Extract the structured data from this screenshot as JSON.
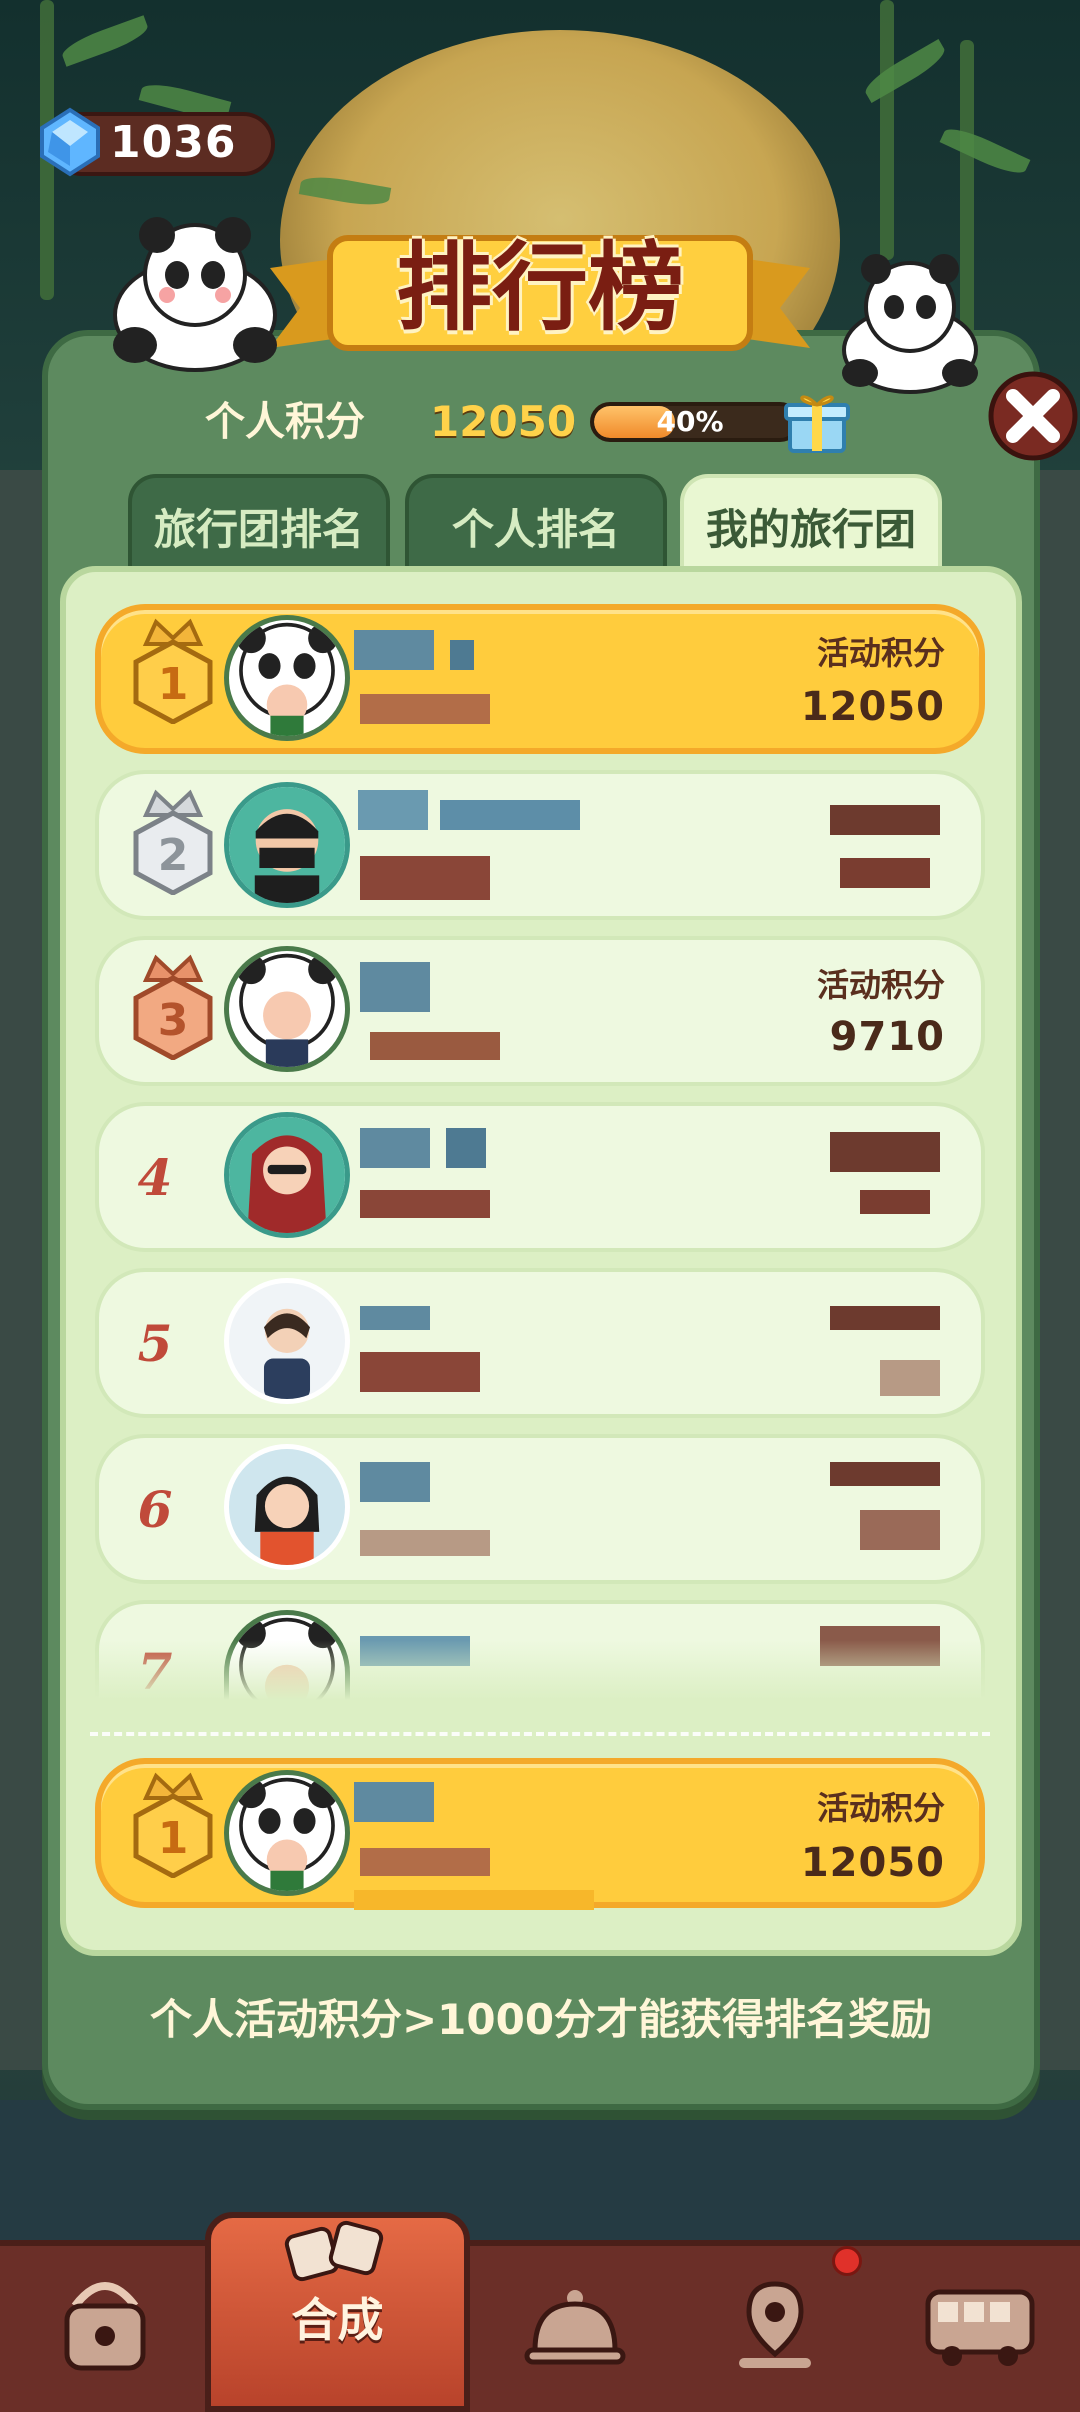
{
  "currency": {
    "icon": "diamond-icon",
    "amount": "1036"
  },
  "header": {
    "title": "排行榜"
  },
  "score": {
    "label": "个人积分",
    "value": "12050",
    "progress": 0.4,
    "progress_text": "40%",
    "reward_icon": "gift-box-icon"
  },
  "tabs": [
    {
      "label": "旅行团排名",
      "active": false
    },
    {
      "label": "个人排名",
      "active": false
    },
    {
      "label": "我的旅行团",
      "active": true
    }
  ],
  "rows": [
    {
      "rank": "1",
      "rank_style": "gold-medal",
      "points_label": "活动积分",
      "points": "12050",
      "highlighted": true,
      "avatar": "panda-hood-avatar"
    },
    {
      "rank": "2",
      "rank_style": "silver-medal",
      "points_label": "",
      "points": "",
      "highlighted": false,
      "avatar": "ninja-avatar"
    },
    {
      "rank": "3",
      "rank_style": "bronze-medal",
      "points_label": "活动积分",
      "points": "9710",
      "highlighted": false,
      "avatar": "panda-hood-avatar"
    },
    {
      "rank": "4",
      "rank_style": "number",
      "points_label": "",
      "points": "",
      "highlighted": false,
      "avatar": "girl-sunglasses-avatar"
    },
    {
      "rank": "5",
      "rank_style": "number",
      "points_label": "",
      "points": "",
      "highlighted": false,
      "avatar": "girl-photo-avatar"
    },
    {
      "rank": "6",
      "rank_style": "number",
      "points_label": "",
      "points": "",
      "highlighted": false,
      "avatar": "girl-headband-avatar"
    },
    {
      "rank": "7",
      "rank_style": "number",
      "points_label": "",
      "points": "",
      "highlighted": false,
      "avatar": "panda-hood-avatar"
    }
  ],
  "my_row": {
    "rank": "1",
    "points_label": "活动积分",
    "points": "12050",
    "avatar": "panda-hood-avatar"
  },
  "footer_note": "个人活动积分>1000分才能获得排名奖励",
  "nav": [
    {
      "icon": "bag-icon",
      "label": ""
    },
    {
      "icon": "merge-icon",
      "label": "合成",
      "active": true
    },
    {
      "icon": "service-bell-icon",
      "label": ""
    },
    {
      "icon": "map-pin-icon",
      "label": ""
    },
    {
      "icon": "bus-icon",
      "label": ""
    }
  ],
  "colors": {
    "gold_row": "#ffcc3d",
    "panel": "#5d8a5f",
    "list_bg": "#dcefc4",
    "nav": "#6b2f28"
  }
}
